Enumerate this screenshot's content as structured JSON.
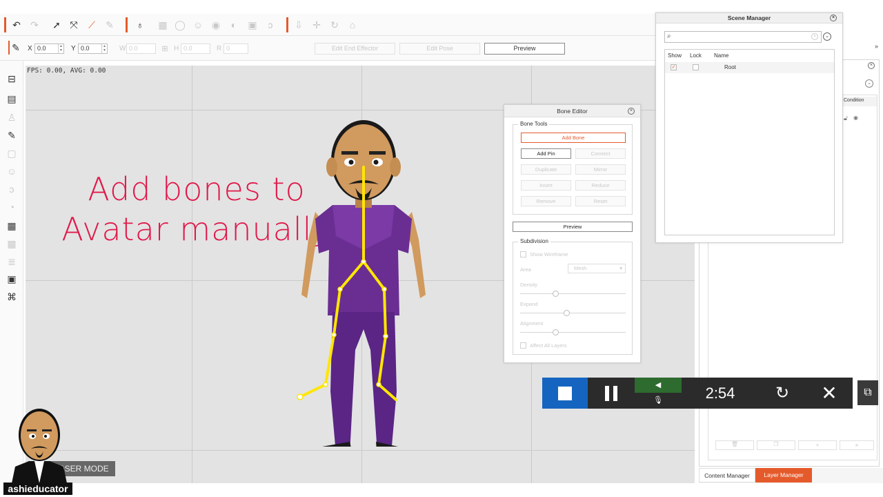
{
  "viewport": {
    "fps": "FPS: 0.00, AVG: 0.00",
    "overlay_line1": "Add bones to",
    "overlay_line2": "Avatar manually",
    "mode_badge": "POSER MODE"
  },
  "props_toolbar": {
    "x_label": "X",
    "x_value": "0.0",
    "y_label": "Y",
    "y_value": "0.0",
    "w_label": "W",
    "w_value": "0.0",
    "h_label": "H",
    "h_value": "0.0",
    "r_label": "R",
    "r_value": "0",
    "edit_end_effector": "Edit End Effector",
    "edit_pose": "Edit Pose",
    "preview": "Preview"
  },
  "bone_editor": {
    "title": "Bone Editor",
    "bone_tools_label": "Bone Tools",
    "add_bone": "Add Bone",
    "add_pin": "Add Pin",
    "connect": "Connect",
    "duplicate": "Duplicate",
    "mirror": "Mirror",
    "insert": "Insert",
    "reduce": "Reduce",
    "remove": "Remove",
    "reset": "Reset",
    "preview": "Preview",
    "subdivision_label": "Subdivision",
    "show_wireframe": "Show Wireframe",
    "area_label": "Area",
    "area_value": "Mesh",
    "density_label": "Density",
    "expand_label": "Expand",
    "alignment_label": "Alignment",
    "affect_all_layers": "Affect All Layers",
    "density_value": 0.5,
    "expand_value": 0.5,
    "alignment_value": 0.5
  },
  "scene_manager": {
    "title": "Scene Manager",
    "col_show": "Show",
    "col_lock": "Lock",
    "col_name": "Name",
    "row_name": "Root"
  },
  "layer_panel": {
    "condition_header": "Condition"
  },
  "bottom_tabs": {
    "content_manager": "Content Manager",
    "layer_manager": "Layer Manager"
  },
  "recorder": {
    "time": "2:54"
  },
  "logo": {
    "text": "ashieducator"
  },
  "colors": {
    "accent": "#e55a2b",
    "overlay_text": "#e0194a",
    "recorder_blue": "#1565c0",
    "bone_yellow": "#ffe600"
  }
}
